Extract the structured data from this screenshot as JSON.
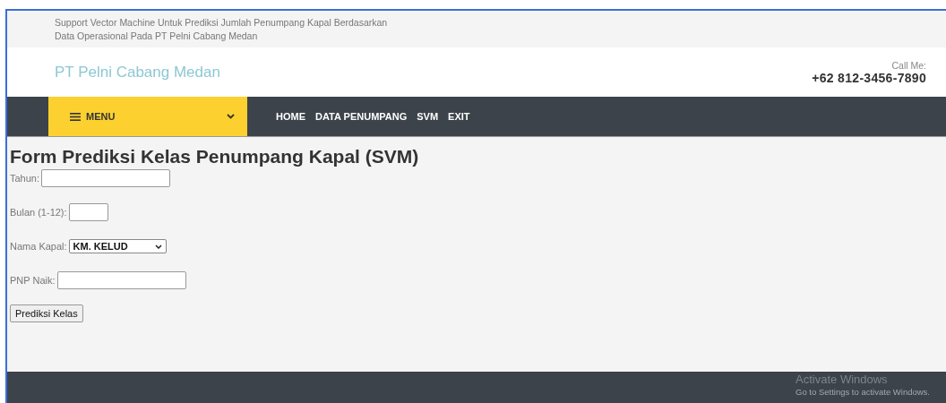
{
  "topbar": {
    "lines": [
      "Support Vector Machine Untuk Prediksi Jumlah Penumpang Kapal Berdasarkan",
      "Data Operasional Pada PT Pelni Cabang Medan"
    ]
  },
  "header": {
    "brand": "PT Pelni Cabang Medan",
    "call_label": "Call Me:",
    "phone": "+62 812-3456-7890"
  },
  "nav": {
    "menu_label": "MENU",
    "links": [
      "HOME",
      "DATA PENUMPANG",
      "SVM",
      "EXIT"
    ]
  },
  "form": {
    "title": "Form Prediksi Kelas Penumpang Kapal (SVM)",
    "fields": [
      {
        "kind": "text",
        "label": "Tahun:"
      },
      {
        "kind": "short",
        "label": "Bulan (1-12):"
      },
      {
        "kind": "select",
        "label": "Nama Kapal:",
        "value": "KM. KELUD"
      },
      {
        "kind": "text",
        "label": "PNP Naik:"
      }
    ],
    "submit": "Prediksi Kelas"
  },
  "os_notice": {
    "title": "Activate Windows",
    "text": "Go to Settings to activate Windows."
  }
}
